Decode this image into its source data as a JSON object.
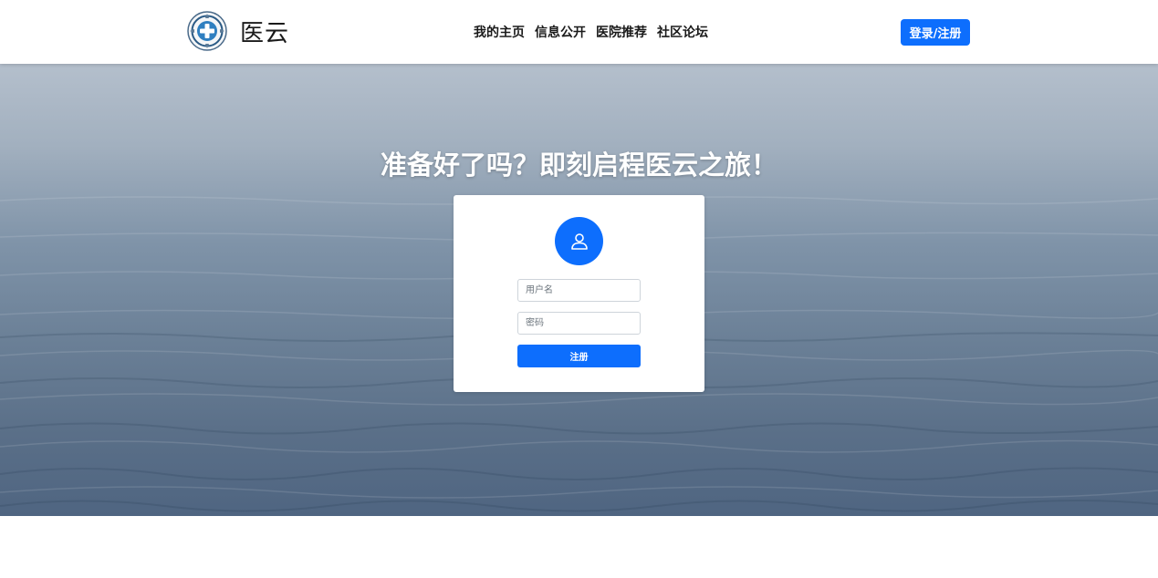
{
  "header": {
    "brand_name": "医云",
    "logo_icon": "medical-cross-compass-logo",
    "nav": [
      {
        "label": "我的主页"
      },
      {
        "label": "信息公开"
      },
      {
        "label": "医院推荐"
      },
      {
        "label": "社区论坛"
      }
    ],
    "login_label": "登录/注册"
  },
  "hero": {
    "title": "准备好了吗？即刻启程医云之旅！",
    "background": "sea-water-photo"
  },
  "register_form": {
    "avatar_icon": "user-icon",
    "username_placeholder": "用户名",
    "password_placeholder": "密码",
    "submit_label": "注册"
  },
  "colors": {
    "accent": "#0d6efd",
    "header_bg": "#ffffff",
    "card_bg": "#ffffff",
    "hero_top": "#b4bfcc",
    "hero_bottom": "#4f6581"
  }
}
